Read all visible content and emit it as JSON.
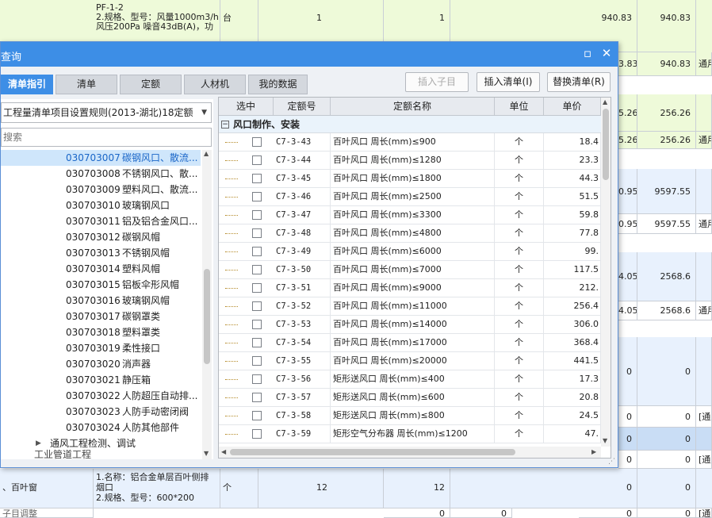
{
  "bg": {
    "top_item": {
      "desc_lines": [
        "PF-1-2",
        "2.规格、型号：风量1000m3/h",
        "风压200Pa  噪音43dB(A)，功"
      ],
      "unit": "台",
      "qty1": "1",
      "qty2": "1",
      "price": "940.83",
      "total": "940.83"
    },
    "right_rows": [
      {
        "price": "3.83",
        "total": "940.83",
        "note": "通用"
      },
      {
        "price": "5.26",
        "total": "256.26",
        "note": ""
      },
      {
        "price": "5.26",
        "total": "256.26",
        "note": "通用"
      },
      {
        "price": "0.95",
        "total": "9597.55",
        "note": ""
      },
      {
        "price": "0.95",
        "total": "9597.55",
        "note": "通用"
      },
      {
        "price": "4.05",
        "total": "2568.6",
        "note": ""
      },
      {
        "price": "4.05",
        "total": "2568.6",
        "note": "通用"
      },
      {
        "price": "0",
        "total": "0",
        "note": ""
      },
      {
        "price": "0",
        "total": "0",
        "note": "[通用"
      },
      {
        "price": "0",
        "total": "0",
        "note": ""
      },
      {
        "price": "0",
        "total": "0",
        "note": "[通用"
      }
    ],
    "bottom_item": {
      "name": "、百叶窗",
      "desc_lines": [
        "1.名称：铝合金单层百叶侧排",
        "烟口",
        "2.规格、型号：600*200"
      ],
      "unit": "个",
      "qty1": "12",
      "qty2": "12",
      "price": "0",
      "total": "0"
    },
    "last_row": {
      "name": "子目调整",
      "v1": "0",
      "v2": "0",
      "v3": "0",
      "v4": "0",
      "note": "[通"
    }
  },
  "dialog": {
    "title": "查询",
    "maximize_icon": "maximize-icon",
    "close_icon": "close-icon",
    "tabs": [
      "清单指引",
      "清单",
      "定额",
      "人材机",
      "我的数据"
    ],
    "buttons": {
      "insert_child": "插入子目",
      "insert_list": "插入清单(I)",
      "replace_list": "替换清单(R)"
    },
    "combo_value": "工程量清单项目设置规则(2013-湖北)18定额",
    "search_placeholder": "搜索",
    "tree": [
      {
        "code": "030703007",
        "name": "碳钢风口、散流...",
        "selected": true
      },
      {
        "code": "030703008",
        "name": "不锈钢风口、散..."
      },
      {
        "code": "030703009",
        "name": "塑料风口、散流..."
      },
      {
        "code": "030703010",
        "name": "玻璃钢风口"
      },
      {
        "code": "030703011",
        "name": "铝及铝合金风口..."
      },
      {
        "code": "030703012",
        "name": "碳钢风帽"
      },
      {
        "code": "030703013",
        "name": "不锈钢风帽"
      },
      {
        "code": "030703014",
        "name": "塑料风帽"
      },
      {
        "code": "030703015",
        "name": "铝板伞形风帽"
      },
      {
        "code": "030703016",
        "name": "玻璃钢风帽"
      },
      {
        "code": "030703017",
        "name": "碳钢罩类"
      },
      {
        "code": "030703018",
        "name": "塑料罩类"
      },
      {
        "code": "030703019",
        "name": "柔性接口"
      },
      {
        "code": "030703020",
        "name": "消声器"
      },
      {
        "code": "030703021",
        "name": "静压箱"
      },
      {
        "code": "030703022",
        "name": "人防超压自动排..."
      },
      {
        "code": "030703023",
        "name": "人防手动密闭阀"
      },
      {
        "code": "030703024",
        "name": "人防其他部件"
      }
    ],
    "tree_folder": "通风工程检测、调试",
    "tree_partial": "工业管道工程",
    "grid_headers": [
      "选中",
      "定额号",
      "定额名称",
      "单位",
      "单价"
    ],
    "group_title": "风口制作、安装",
    "rows": [
      {
        "code": "C7-3-43",
        "name": "百叶风口 周长(mm)≤900",
        "unit": "个",
        "price": "18.4"
      },
      {
        "code": "C7-3-44",
        "name": "百叶风口 周长(mm)≤1280",
        "unit": "个",
        "price": "23.3"
      },
      {
        "code": "C7-3-45",
        "name": "百叶风口 周长(mm)≤1800",
        "unit": "个",
        "price": "44.3"
      },
      {
        "code": "C7-3-46",
        "name": "百叶风口 周长(mm)≤2500",
        "unit": "个",
        "price": "51.5"
      },
      {
        "code": "C7-3-47",
        "name": "百叶风口 周长(mm)≤3300",
        "unit": "个",
        "price": "59.8"
      },
      {
        "code": "C7-3-48",
        "name": "百叶风口 周长(mm)≤4800",
        "unit": "个",
        "price": "77.8"
      },
      {
        "code": "C7-3-49",
        "name": "百叶风口 周长(mm)≤6000",
        "unit": "个",
        "price": "99."
      },
      {
        "code": "C7-3-50",
        "name": "百叶风口 周长(mm)≤7000",
        "unit": "个",
        "price": "117.5"
      },
      {
        "code": "C7-3-51",
        "name": "百叶风口 周长(mm)≤9000",
        "unit": "个",
        "price": "212."
      },
      {
        "code": "C7-3-52",
        "name": "百叶风口 周长(mm)≤11000",
        "unit": "个",
        "price": "256.4"
      },
      {
        "code": "C7-3-53",
        "name": "百叶风口 周长(mm)≤14000",
        "unit": "个",
        "price": "306.0"
      },
      {
        "code": "C7-3-54",
        "name": "百叶风口 周长(mm)≤17000",
        "unit": "个",
        "price": "368.4"
      },
      {
        "code": "C7-3-55",
        "name": "百叶风口 周长(mm)≤20000",
        "unit": "个",
        "price": "441.5"
      },
      {
        "code": "C7-3-56",
        "name": "矩形送风口 周长(mm)≤400",
        "unit": "个",
        "price": "17.3"
      },
      {
        "code": "C7-3-57",
        "name": "矩形送风口 周长(mm)≤600",
        "unit": "个",
        "price": "20.8"
      },
      {
        "code": "C7-3-58",
        "name": "矩形送风口 周长(mm)≤800",
        "unit": "个",
        "price": "24.5"
      },
      {
        "code": "C7-3-59",
        "name": "矩形空气分布器 周长(mm)≤1200",
        "unit": "个",
        "price": "47."
      }
    ]
  }
}
